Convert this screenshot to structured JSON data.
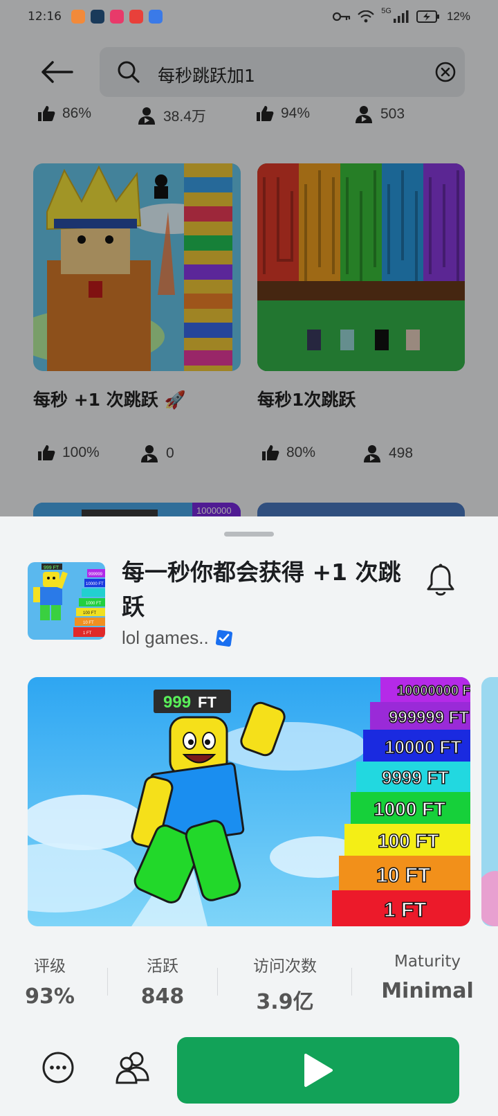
{
  "status_bar": {
    "time": "12:16",
    "signal_label": "5G",
    "battery": "12%"
  },
  "search": {
    "back_icon": "arrow-left-icon",
    "query": "每秒跳跃加1",
    "clear_icon": "close-circle-icon"
  },
  "results": {
    "top_row": [
      {
        "rating": "86%",
        "players": "38.4万"
      },
      {
        "rating": "94%",
        "players": "503"
      }
    ],
    "cards": [
      {
        "title": "每秒 +1 次跳跃 🚀",
        "rating": "100%",
        "players": "0"
      },
      {
        "title": "每秒1次跳跃",
        "rating": "80%",
        "players": "498"
      }
    ],
    "partial_card_tag": "1000000"
  },
  "sheet": {
    "title": "每一秒你都会获得 +1 次跳跃",
    "creator": "lol games..",
    "thumb_ladder": [
      "999999",
      "10000 FT",
      "1000 FT",
      "100 FT",
      "10 FT",
      "1 FT"
    ],
    "thumb_tag": "999 FT",
    "hero": {
      "tag_number": "999",
      "tag_unit": "FT",
      "ladder": [
        "10000000 F",
        "999999 FT",
        "10000 FT",
        "9999 FT",
        "1000 FT",
        "100 FT",
        "10 FT",
        "1 FT"
      ]
    },
    "stats": [
      {
        "label": "评级",
        "value": "93%"
      },
      {
        "label": "活跃",
        "value": "848"
      },
      {
        "label": "访问次数",
        "value": "3.9亿"
      },
      {
        "label": "Maturity",
        "value": "Minimal"
      }
    ]
  },
  "colors": {
    "play": "#12a258",
    "sheet_bg": "#f2f4f5",
    "verified": "#1a6ff0"
  }
}
